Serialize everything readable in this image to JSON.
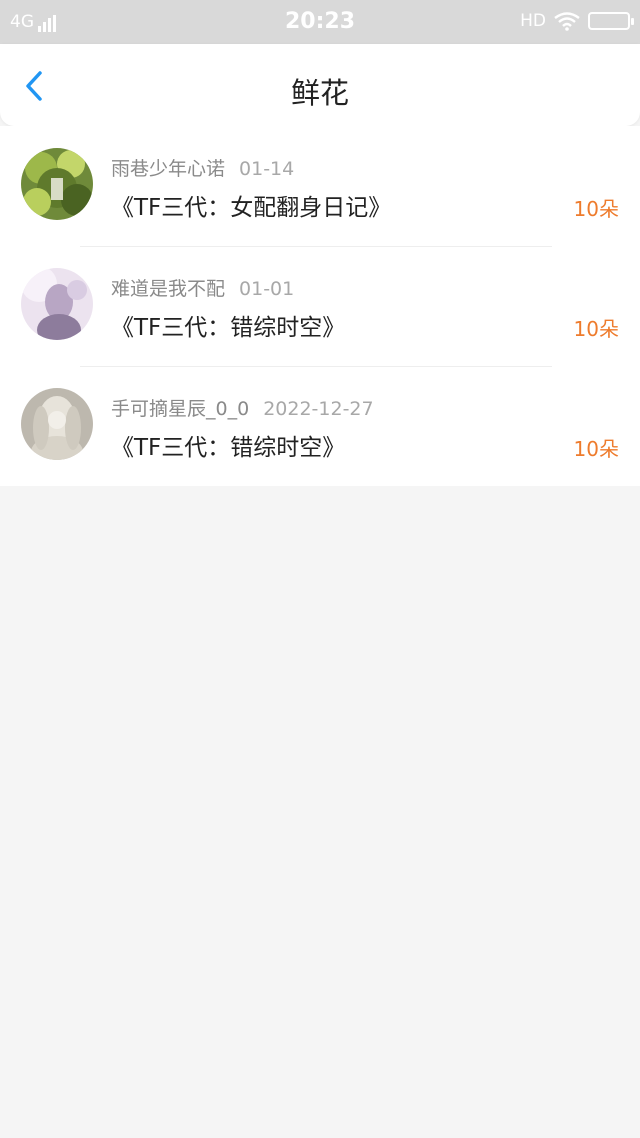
{
  "status_bar": {
    "network": "4G",
    "time": "20:23",
    "hd": "HD"
  },
  "header": {
    "title": "鲜花"
  },
  "items": [
    {
      "user": "雨巷少年心诺",
      "date": "01-14",
      "book": "《TF三代：女配翻身日记》",
      "amount": "10朵"
    },
    {
      "user": "难道是我不配",
      "date": "01-01",
      "book": "《TF三代：错综时空》",
      "amount": "10朵"
    },
    {
      "user": "手可摘星辰_0_0",
      "date": "2022-12-27",
      "book": "《TF三代：错综时空》",
      "amount": "10朵"
    }
  ],
  "colors": {
    "accent": "#2196f3",
    "amount": "#ee7b2c",
    "status_bar_bg": "#d9d9d9",
    "page_bg": "#f5f5f5"
  }
}
